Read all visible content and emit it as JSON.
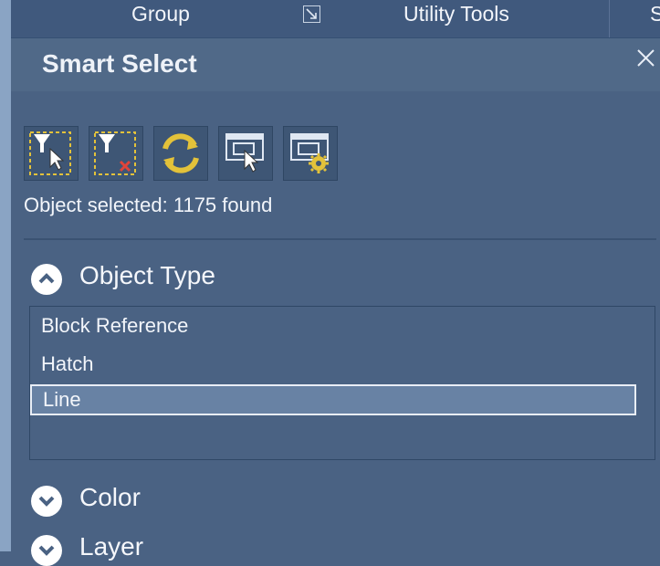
{
  "ribbon": {
    "group_label": "Group",
    "utility_label": "Utility Tools",
    "next_tab_partial": "S"
  },
  "panel": {
    "title": "Smart Select",
    "status": "Object selected: 1175 found"
  },
  "toolbar": {
    "tools": [
      {
        "icon": "filter-select-icon"
      },
      {
        "icon": "filter-clear-icon"
      },
      {
        "icon": "refresh-icon"
      },
      {
        "icon": "window-select-icon"
      },
      {
        "icon": "window-settings-icon"
      }
    ]
  },
  "sections": {
    "object_type": {
      "label": "Object Type",
      "expanded": true,
      "items": [
        "Block Reference",
        "Hatch",
        "Line"
      ],
      "selected": "Line"
    },
    "color": {
      "label": "Color",
      "expanded": false
    },
    "layer": {
      "label": "Layer",
      "expanded": false
    }
  },
  "colors": {
    "panel_bg": "#4a6283",
    "header_bg": "#506988",
    "ribbon_bg": "#40597d",
    "selection_bg": "#6882a4",
    "icon_yellow": "#e3c23a"
  }
}
